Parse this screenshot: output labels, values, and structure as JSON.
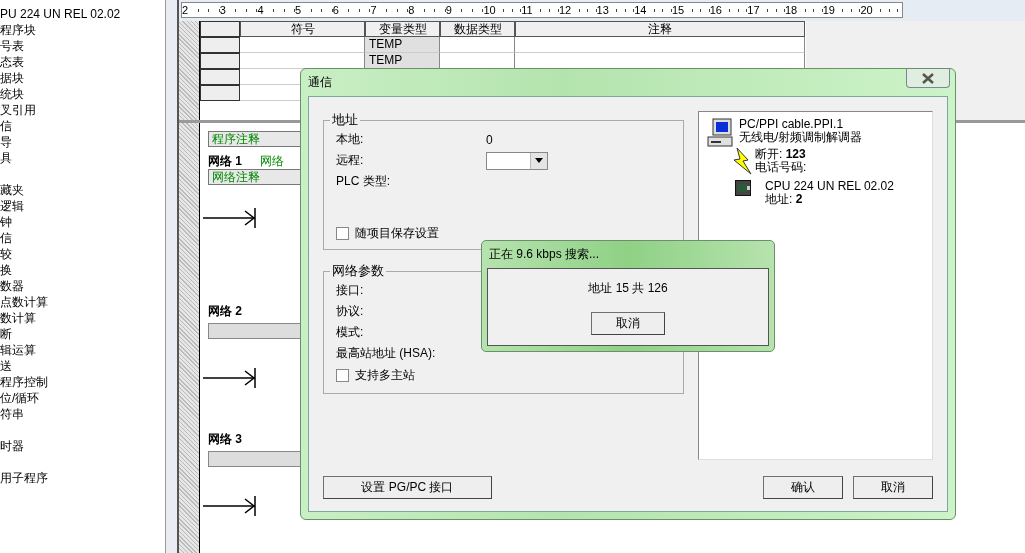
{
  "tree": {
    "items": [
      "PU 224 UN REL 02.02",
      "程序块",
      "号表",
      "态表",
      "据块",
      "统块",
      "叉引用",
      "信",
      "导",
      "具"
    ]
  },
  "instructions": {
    "items": [
      "藏夹",
      "逻辑",
      "钟",
      "信",
      "较",
      "换",
      "数器",
      "点数计算",
      "数计算",
      "断",
      "辑运算",
      "送",
      "程序控制",
      "位/循环",
      "符串"
    ],
    "more": [
      "时器"
    ],
    "last": [
      "用子程序"
    ]
  },
  "ruler": [
    "2",
    "3",
    "4",
    "5",
    "6",
    "7",
    "8",
    "9",
    "10",
    "11",
    "12",
    "13",
    "14",
    "15",
    "16",
    "17",
    "18",
    "19",
    "20"
  ],
  "var_table": {
    "columns": [
      "符号",
      "变量类型",
      "数据类型",
      "注释"
    ],
    "rows": [
      {
        "var_type": "TEMP"
      },
      {
        "var_type": "TEMP"
      }
    ]
  },
  "program": {
    "comment": "程序注释",
    "networks": [
      {
        "title": "网络 1",
        "label": "网络",
        "comment": "网络注释"
      },
      {
        "title": "网络 2"
      },
      {
        "title": "网络 3"
      }
    ]
  },
  "dialog": {
    "title": "通信",
    "address": {
      "legend": "地址",
      "local_label": "本地:",
      "local_value": "0",
      "remote_label": "远程:",
      "plc_type_label": "PLC 类型:",
      "save_with_project": {
        "label": "随项目保存设置",
        "checked": false
      }
    },
    "network": {
      "legend": "网络参数",
      "fields": [
        "接口:",
        "协议:",
        "模式:",
        "最高站地址 (HSA):"
      ],
      "multi_master": {
        "label": "支持多主站",
        "checked": false
      }
    },
    "tree": {
      "cable": "PC/PPI cable.PPI.1",
      "modem": "无线电/射频调制解调器",
      "hangup": "断开: **123**",
      "phone": "电话号码:",
      "cpu": "CPU 224 UN REL 02.02",
      "cpu_address": "地址: **2**"
    },
    "buttons": {
      "pgpc": "设置 PG/PC 接口",
      "ok": "确认",
      "cancel": "取消"
    }
  },
  "search_popup": {
    "title": "正在 9.6 kbps 搜索...",
    "progress": "地址 15 共 126",
    "cancel": "取消"
  }
}
